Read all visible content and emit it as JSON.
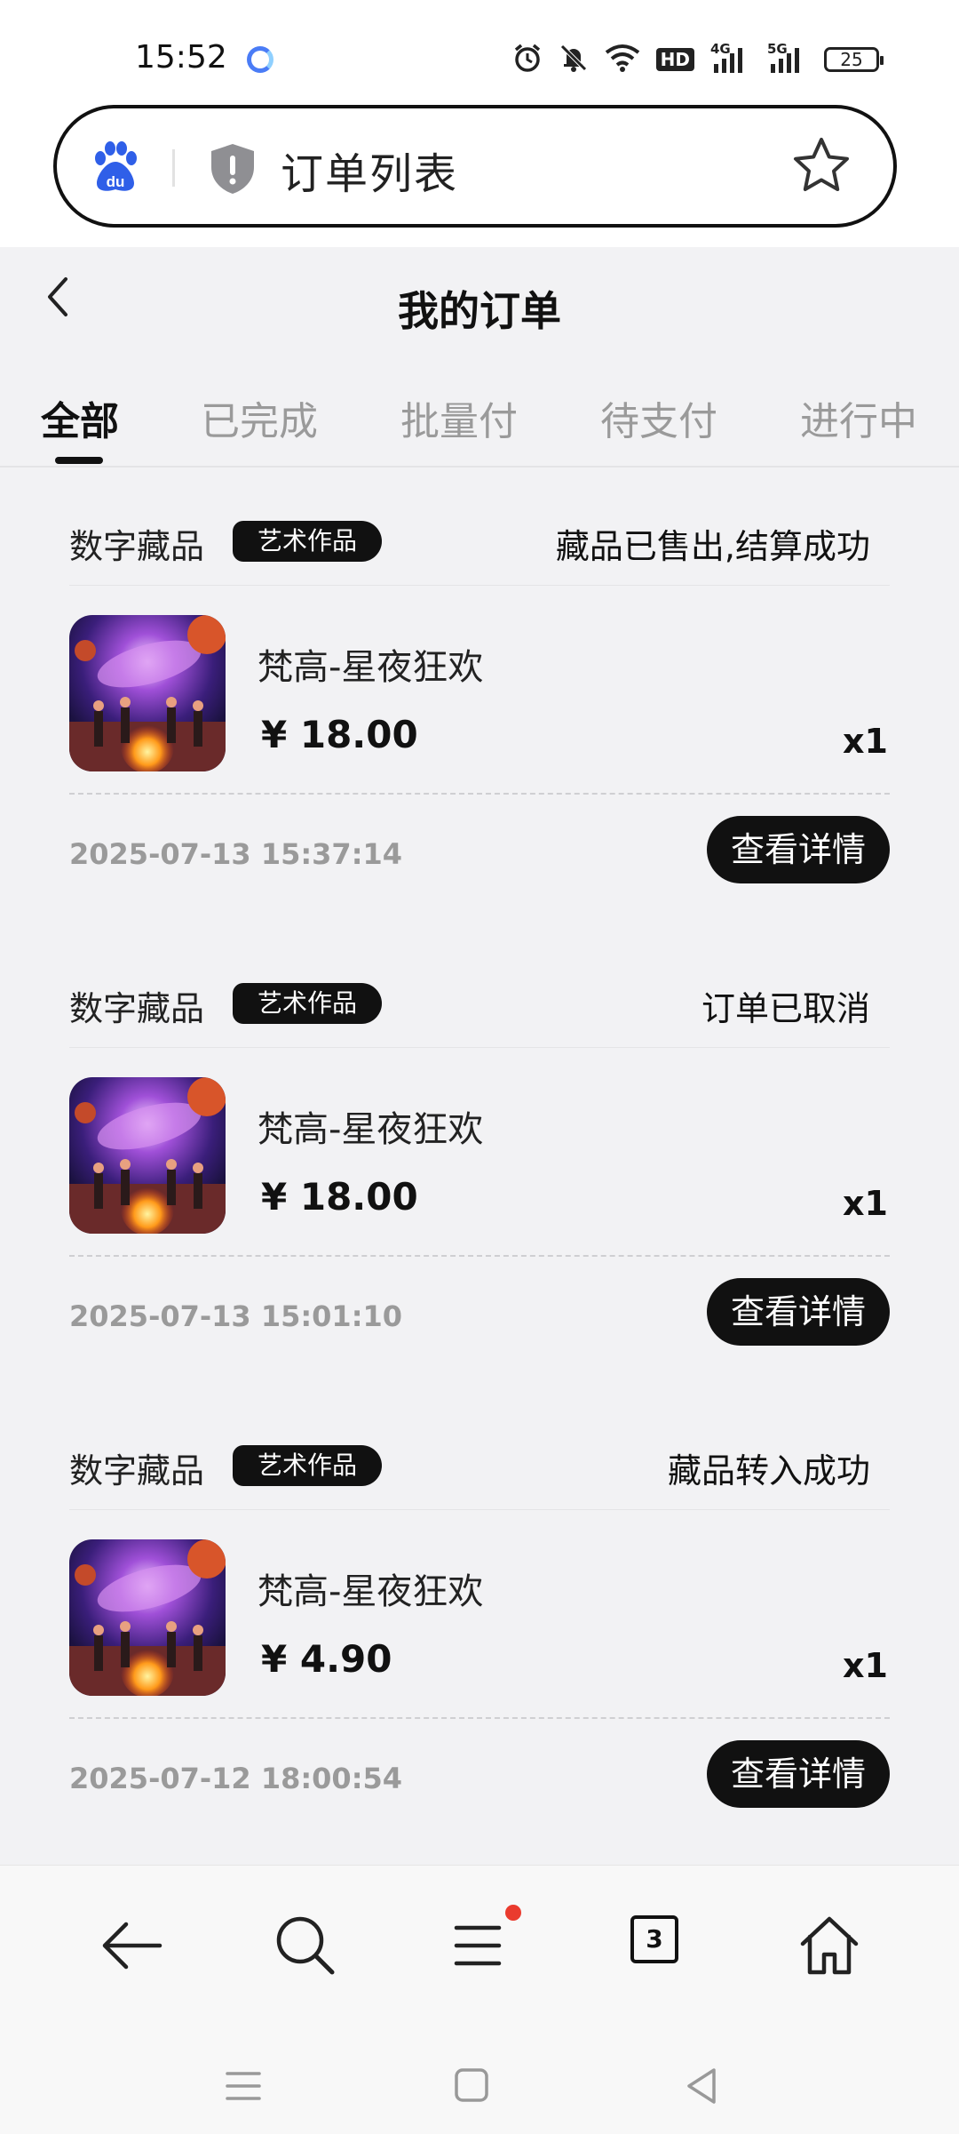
{
  "status_bar": {
    "time": "15:52",
    "network_4g": "4G",
    "network_5g": "5G",
    "hd": "HD",
    "battery": "25"
  },
  "address_bar": {
    "title": "订单列表"
  },
  "header": {
    "title": "我的订单"
  },
  "tabs": [
    {
      "label": "全部",
      "active": true
    },
    {
      "label": "已完成",
      "active": false
    },
    {
      "label": "批量付",
      "active": false
    },
    {
      "label": "待支付",
      "active": false
    },
    {
      "label": "进行中",
      "active": false
    }
  ],
  "orders": [
    {
      "category": "数字藏品",
      "badge": "艺术作品",
      "status": "藏品已售出,结算成功",
      "name": "梵高-星夜狂欢",
      "price": "¥ 18.00",
      "qty": "x1",
      "time": "2025-07-13 15:37:14",
      "detail_label": "查看详情"
    },
    {
      "category": "数字藏品",
      "badge": "艺术作品",
      "status": "订单已取消",
      "name": "梵高-星夜狂欢",
      "price": "¥ 18.00",
      "qty": "x1",
      "time": "2025-07-13 15:01:10",
      "detail_label": "查看详情"
    },
    {
      "category": "数字藏品",
      "badge": "艺术作品",
      "status": "藏品转入成功",
      "name": "梵高-星夜狂欢",
      "price": "¥ 4.90",
      "qty": "x1",
      "time": "2025-07-12 18:00:54",
      "detail_label": "查看详情"
    }
  ],
  "bottom_nav": {
    "tab_count": "3"
  },
  "icons": [
    "back-arrow-icon",
    "search-icon",
    "menu-icon",
    "tabs-icon",
    "home-icon",
    "star-icon",
    "shield-icon",
    "baidu-icon"
  ],
  "colors": {
    "primary": "#111111",
    "muted": "#9a9a9a",
    "background": "#f2f2f4",
    "notification": "#ea3b2e"
  }
}
